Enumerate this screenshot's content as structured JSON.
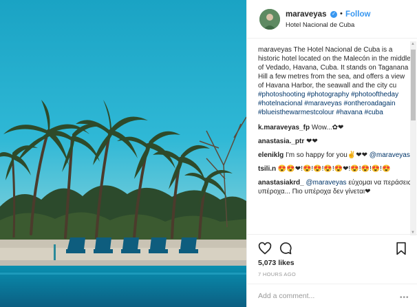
{
  "post": {
    "username": "maraveyas",
    "dot": "•",
    "follow_label": "Follow",
    "location": "Hotel Nacional de Cuba",
    "verified_glyph": "✓"
  },
  "caption": {
    "username": "maraveyas",
    "text": "The Hotel Nacional de Cuba is a historic hotel located on the Malecón in the middle of Vedado, Havana, Cuba. It stands on Taganana Hill a few metres from the sea, and offers a view of Havana Harbor, the seawall and the city cu",
    "hashtags": "#photoshooting #photography #photooftheday #hotelnacional #maraveyas #ontheroadagain #blueisthewarmestcolour #havana #cuba"
  },
  "comments": [
    {
      "username": "k.maraveyas_fp",
      "text": "Wow...✿❤"
    },
    {
      "username": "anastasia._ptr",
      "text": "❤❤"
    },
    {
      "username": "eleniklg",
      "text": "I'm so happy for you✌❤❤",
      "mention": "@maraveyas"
    },
    {
      "username": "tsili.n",
      "text": "😍😍❤!😍!😍!😍!😍❤!😍!😍!😍!😍"
    },
    {
      "username": "anastasiakrd_",
      "mention": "@maraveyas",
      "text": "εύχομαι να περάσεις υπέροχα... Πιο υπέροχα δεν γίνεται❤"
    }
  ],
  "likes": "5,073 likes",
  "time": "7 HOURS AGO",
  "add_comment": {
    "placeholder": "Add a comment..."
  },
  "more_glyph": "•••",
  "icons": {
    "like": "heart-icon",
    "comment": "speech-bubble-icon",
    "save": "bookmark-icon",
    "verified": "verified-badge-icon"
  },
  "colors": {
    "link": "#3897f0",
    "hashtag": "#003569",
    "text": "#262626",
    "muted": "#999999"
  }
}
